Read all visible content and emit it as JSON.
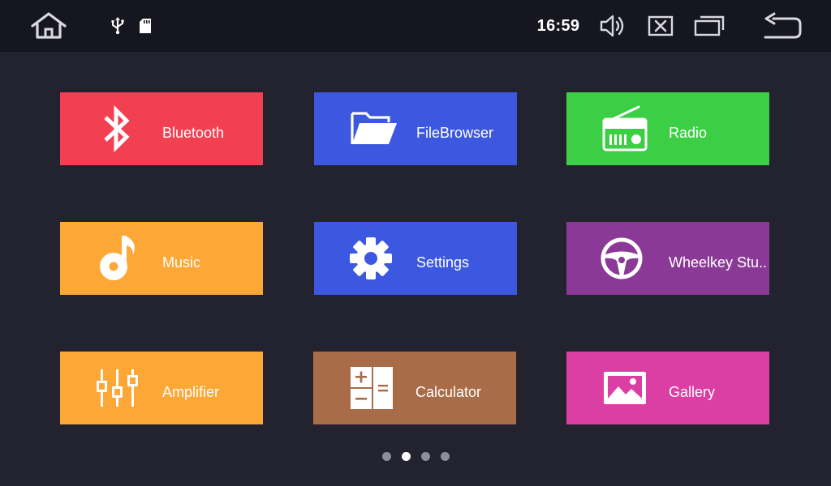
{
  "status_bar": {
    "time": "16:59",
    "icons": {
      "home": "home-icon",
      "usb": "usb-icon",
      "sd_card": "sd-card-icon",
      "volume": "volume-icon",
      "close": "close-icon",
      "recent_apps": "recent-apps-icon",
      "back": "back-icon"
    }
  },
  "tiles": [
    {
      "label": "Bluetooth",
      "color": "#f33f52",
      "icon": "bluetooth-icon"
    },
    {
      "label": "FileBrowser",
      "color": "#3c57e0",
      "icon": "folder-icon"
    },
    {
      "label": "Radio",
      "color": "#3ccf45",
      "icon": "radio-icon"
    },
    {
      "label": "Music",
      "color": "#fda836",
      "icon": "music-note-icon"
    },
    {
      "label": "Settings",
      "color": "#3c57e0",
      "icon": "gear-icon"
    },
    {
      "label": "Wheelkey Stu..",
      "color": "#8a3a96",
      "icon": "steering-wheel-icon"
    },
    {
      "label": "Amplifier",
      "color": "#fda836",
      "icon": "equalizer-icon"
    },
    {
      "label": "Calculator",
      "color": "#a86c48",
      "icon": "calculator-icon"
    },
    {
      "label": "Gallery",
      "color": "#dc3fa4",
      "icon": "image-icon"
    }
  ],
  "pagination": {
    "total": 4,
    "active_index": 1
  }
}
